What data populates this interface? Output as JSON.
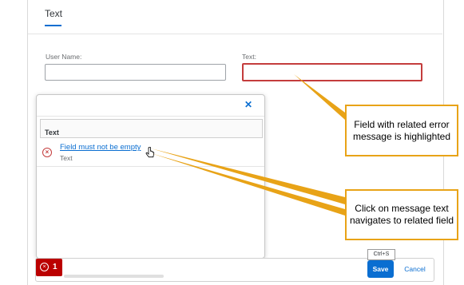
{
  "tab": {
    "label": "Text"
  },
  "form": {
    "username_label": "User Name:",
    "text_label": "Text:"
  },
  "popover": {
    "close_icon": "close-icon",
    "group_header": "Text",
    "message": {
      "title": "Field must not be empty",
      "subtitle": "Text"
    }
  },
  "footer": {
    "error_count": "1",
    "save_label": "Save",
    "cancel_label": "Cancel",
    "save_shortcut": "Ctrl+S"
  },
  "callouts": {
    "highlight": "Field with related error message is highlighted",
    "navigate": "Click on message text navigates to related field"
  },
  "colors": {
    "brand": "#0a6ed1",
    "error": "#bb0000",
    "callout_border": "#e8a317"
  }
}
